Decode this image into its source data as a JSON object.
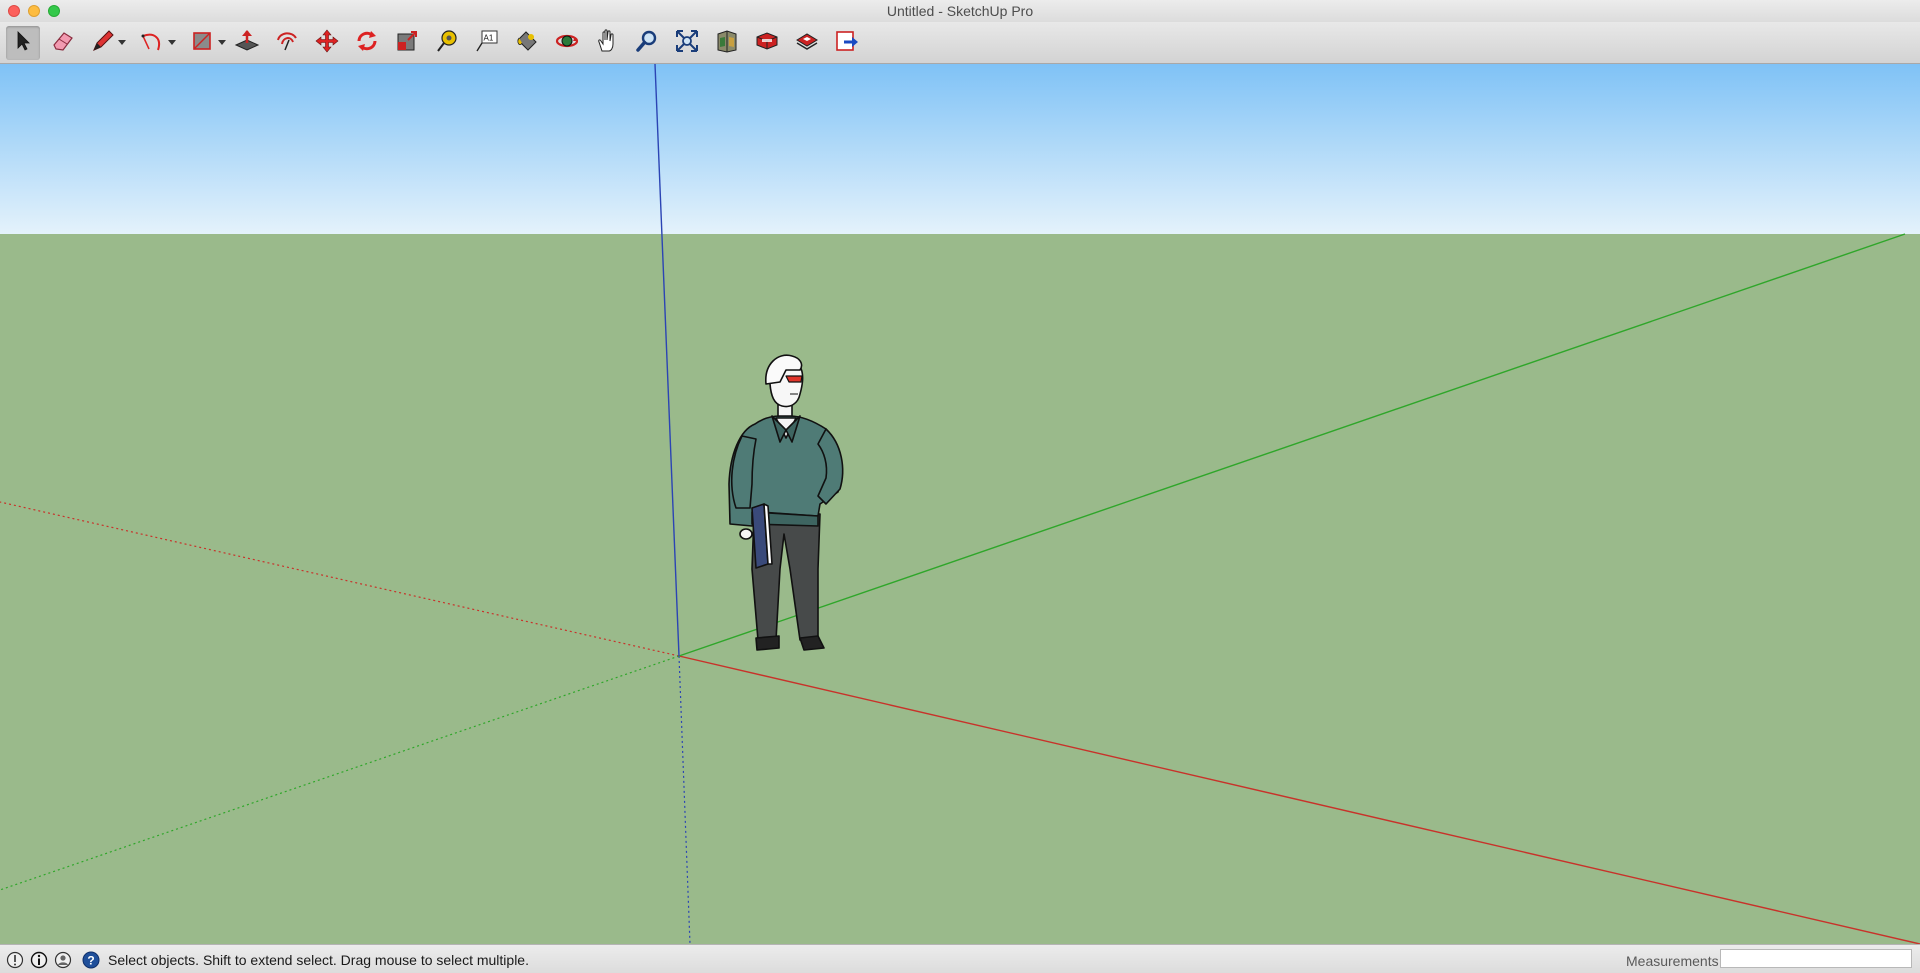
{
  "window": {
    "title": "Untitled - SketchUp Pro"
  },
  "toolbar": {
    "tools": [
      {
        "name": "select-tool",
        "icon": "arrow-cursor-icon",
        "active": true
      },
      {
        "name": "eraser-tool",
        "icon": "eraser-icon"
      },
      {
        "name": "line-tool",
        "icon": "pencil-icon",
        "dropdown": true
      },
      {
        "name": "arc-tool",
        "icon": "arc-icon",
        "dropdown": true
      },
      {
        "name": "shapes-tool",
        "icon": "rectangle-icon",
        "dropdown": true
      },
      {
        "name": "push-pull-tool",
        "icon": "push-pull-icon"
      },
      {
        "name": "offset-tool",
        "icon": "offset-icon"
      },
      {
        "name": "move-tool",
        "icon": "move-icon"
      },
      {
        "name": "rotate-tool",
        "icon": "rotate-icon"
      },
      {
        "name": "scale-tool",
        "icon": "scale-icon"
      },
      {
        "name": "tape-measure-tool",
        "icon": "tape-measure-icon"
      },
      {
        "name": "text-tool",
        "icon": "text-label-icon"
      },
      {
        "name": "paint-bucket-tool",
        "icon": "paint-bucket-icon"
      },
      {
        "name": "orbit-tool",
        "icon": "orbit-icon"
      },
      {
        "name": "pan-tool",
        "icon": "hand-icon"
      },
      {
        "name": "zoom-tool",
        "icon": "magnifier-icon"
      },
      {
        "name": "zoom-extents-tool",
        "icon": "zoom-extents-icon"
      },
      {
        "name": "3d-warehouse-button",
        "icon": "warehouse-icon"
      },
      {
        "name": "extension-warehouse-button",
        "icon": "extension-warehouse-icon"
      },
      {
        "name": "layout-send-button",
        "icon": "layout-icon"
      },
      {
        "name": "export-button",
        "icon": "export-icon"
      }
    ],
    "text_tool_glyph": "A1"
  },
  "status": {
    "hint": "Select objects. Shift to extend select. Drag mouse to select multiple.",
    "measurements_label": "Measurements",
    "measurements_value": "",
    "help_glyph": "?"
  },
  "colors": {
    "sky_top": "#7fc2f6",
    "sky_bottom": "#e4f2fb",
    "ground": "#9aba8b",
    "axis_red": "#c8322a",
    "axis_green": "#2fa62a",
    "axis_blue": "#2b44b4"
  }
}
